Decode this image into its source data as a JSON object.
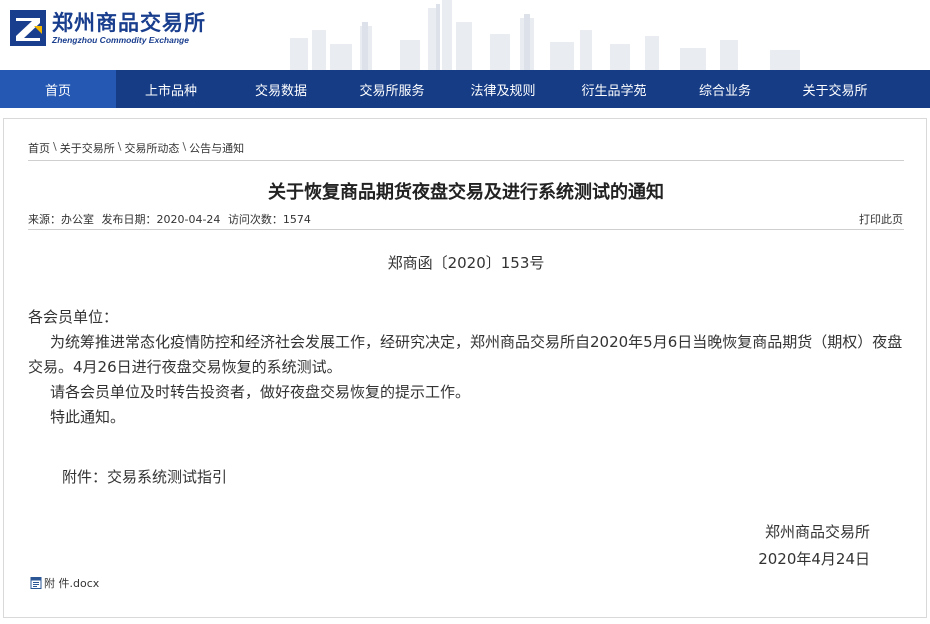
{
  "header": {
    "logo_cn": "郑州商品交易所",
    "logo_en": "Zhengzhou Commodity Exchange"
  },
  "nav": {
    "items": [
      {
        "label": "首页",
        "active": true
      },
      {
        "label": "上市品种"
      },
      {
        "label": "交易数据"
      },
      {
        "label": "交易所服务"
      },
      {
        "label": "法律及规则"
      },
      {
        "label": "衍生品学苑"
      },
      {
        "label": "综合业务"
      },
      {
        "label": "关于交易所"
      }
    ]
  },
  "breadcrumb": {
    "items": [
      "首页",
      "关于交易所",
      "交易所动态",
      "公告与通知"
    ],
    "separator": "\\"
  },
  "article": {
    "title": "关于恢复商品期货夜盘交易及进行系统测试的通知",
    "source": "来源：办公室",
    "date": "发布日期：2020-04-24",
    "visits": "访问次数：1574",
    "print_label": "打印此页",
    "doc_number": "郑商函〔2020〕153号",
    "salutation": "各会员单位：",
    "para1": "为统筹推进常态化疫情防控和经济社会发展工作，经研究决定，郑州商品交易所自2020年5月6日当晚恢复商品期货（期权）夜盘交易。4月26日进行夜盘交易恢复的系统测试。",
    "para2": "请各会员单位及时转告投资者，做好夜盘交易恢复的提示工作。",
    "para3": "特此通知。",
    "attachment_note": "附件：交易系统测试指引",
    "sign_org": "郑州商品交易所",
    "sign_date": "2020年4月24日",
    "file_name": "附 件.docx"
  },
  "colors": {
    "nav_bg": "#163c86",
    "nav_active": "#2558b3",
    "brand": "#1a3e8e"
  }
}
